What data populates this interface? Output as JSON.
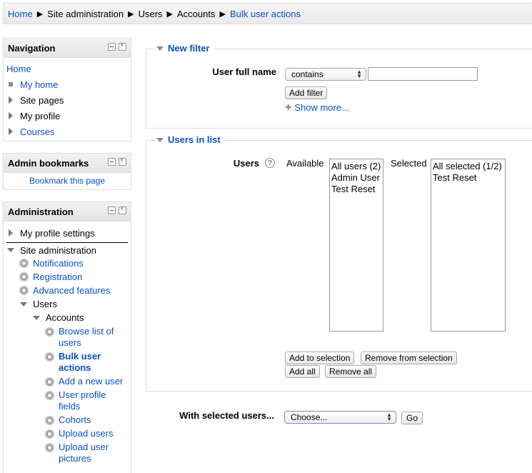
{
  "breadcrumb": [
    "Home",
    "Site administration",
    "Users",
    "Accounts",
    "Bulk user actions"
  ],
  "navigation": {
    "title": "Navigation",
    "home": "Home",
    "items": [
      "My home",
      "Site pages",
      "My profile",
      "Courses"
    ]
  },
  "admin_bookmarks": {
    "title": "Admin bookmarks",
    "link": "Bookmark this page"
  },
  "administration": {
    "title": "Administration",
    "my_profile_settings": "My profile settings",
    "site_administration": "Site administration",
    "site_items": [
      "Notifications",
      "Registration",
      "Advanced features"
    ],
    "users": "Users",
    "accounts": "Accounts",
    "account_items": [
      [
        "Browse list of",
        "users"
      ],
      [
        "Bulk user",
        "actions"
      ],
      [
        "Add a new user"
      ],
      [
        "User profile",
        "fields"
      ],
      [
        "Cohorts"
      ],
      [
        "Upload users"
      ],
      [
        "Upload user",
        "pictures"
      ]
    ]
  },
  "new_filter": {
    "legend": "New filter",
    "label": "User full name",
    "operator": "contains",
    "value": "",
    "add_button": "Add filter",
    "show_more": "Show more..."
  },
  "users_in_list": {
    "legend": "Users in list",
    "label": "Users",
    "available_label": "Available",
    "available": [
      "All users (2)",
      "Admin User",
      "Test Reset"
    ],
    "selected_label": "Selected",
    "selected": [
      "All selected (1/2)",
      "Test Reset"
    ],
    "add_to_selection": "Add to selection",
    "remove_from_selection": "Remove from selection",
    "add_all": "Add all",
    "remove_all": "Remove all"
  },
  "with_selected": {
    "label": "With selected users...",
    "choose": "Choose...",
    "go": "Go"
  },
  "colors": {
    "link": "#0a50c8",
    "border": "#dddddd"
  }
}
